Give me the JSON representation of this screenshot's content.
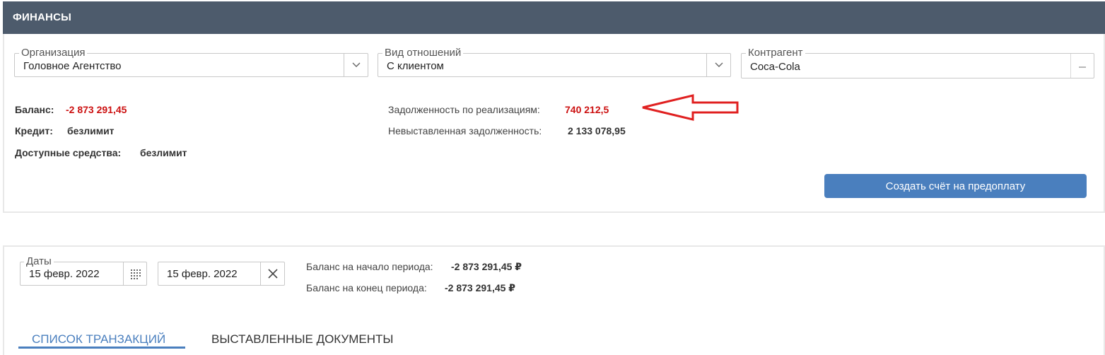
{
  "header": {
    "title": "ФИНАНСЫ"
  },
  "filters": {
    "organization": {
      "legend": "Организация",
      "value": "Головное Агентство",
      "icon": "chevron-down-icon"
    },
    "relation": {
      "legend": "Вид отношений",
      "value": "С клиентом",
      "icon": "chevron-down-icon"
    },
    "counterparty": {
      "legend": "Контрагент",
      "value": "Coca-Cola",
      "icon": "ellipsis-icon"
    }
  },
  "summary": {
    "balance_label": "Баланс:",
    "balance_value": "-2 873 291,45",
    "credit_label": "Кредит:",
    "credit_value": "безлимит",
    "available_label": "Доступные средства:",
    "available_value": "безлимит",
    "sales_debt_label": "Задолженность по реализациям:",
    "sales_debt_value": "740 212,5",
    "unbilled_debt_label": "Невыставленная задолженность:",
    "unbilled_debt_value": "2 133 078,95"
  },
  "actions": {
    "create_prepay_invoice": "Создать счёт на предоплату"
  },
  "period": {
    "legend": "Даты",
    "date_from": "15 февр. 2022",
    "date_to": "15 февр. 2022",
    "start_balance_label": "Баланс на начало периода:",
    "start_balance_value": "-2 873 291,45 ₽",
    "end_balance_label": "Баланс на конец периода:",
    "end_balance_value": "-2 873 291,45 ₽"
  },
  "tabs": [
    {
      "label": "СПИСОК ТРАНЗАКЦИЙ",
      "active": true
    },
    {
      "label": "ВЫСТАВЛЕННЫЕ ДОКУМЕНТЫ",
      "active": false
    }
  ],
  "colors": {
    "header_bg": "#4d5b6c",
    "accent": "#4a7fbe",
    "negative": "#cc1111",
    "annotation_arrow": "#e02020"
  }
}
